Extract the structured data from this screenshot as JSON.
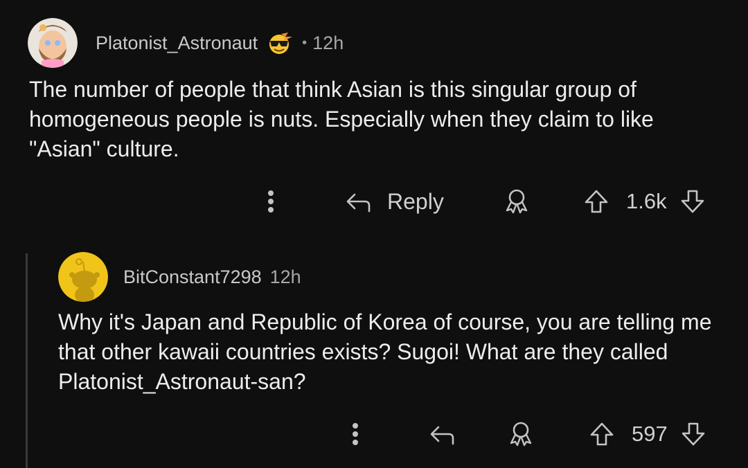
{
  "comment": {
    "username": "Platonist_Astronaut",
    "separator": "•",
    "timestamp": "12h",
    "body": "The number of people that think Asian is this singular group of homogeneous people is nuts. Especially when they claim to like \"Asian\" culture.",
    "actions": {
      "reply_label": "Reply",
      "score": "1.6k"
    }
  },
  "reply": {
    "username": "BitConstant7298",
    "timestamp": "12h",
    "body": "Why it's Japan and Republic of Korea of course, you are telling me that other kawaii countries exists? Sugoi! What are they called Platonist_Astronaut-san?",
    "actions": {
      "score": "597"
    }
  },
  "icons": {
    "more": "more-vertical-icon",
    "reply": "reply-arrow-icon",
    "award": "award-icon",
    "upvote": "upvote-arrow-icon",
    "downvote": "downvote-arrow-icon"
  },
  "colors": {
    "background": "#0f0f0f",
    "text": "#ededed",
    "muted": "#a8a8a8",
    "thread_line": "#3a3a3a",
    "default_avatar": "#f0c419"
  }
}
